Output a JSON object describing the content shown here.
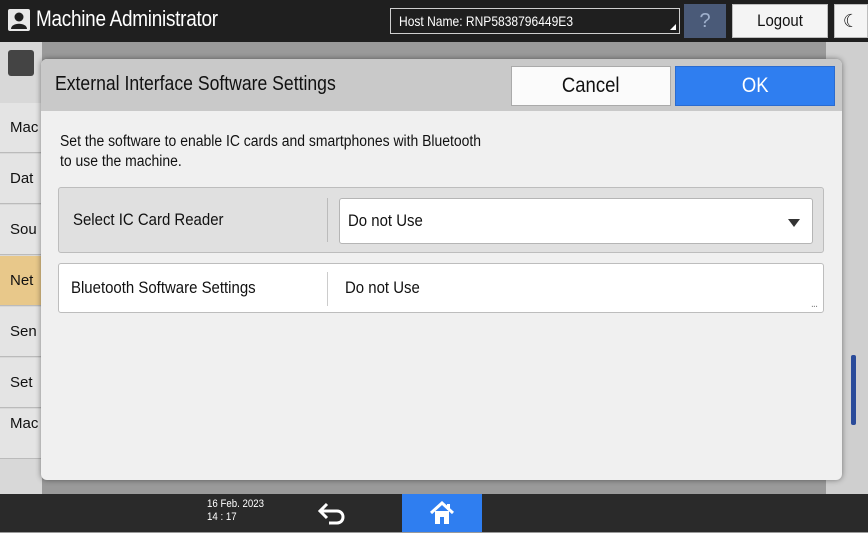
{
  "topbar": {
    "user_icon": "user-icon",
    "title": "Machine Administrator",
    "host": "Host Name: RNP5838796449E3",
    "help_label": "?",
    "logout_label": "Logout",
    "moon_icon": "moon-icon"
  },
  "sidebar": {
    "items": [
      {
        "label": "Mac"
      },
      {
        "label": "Dat"
      },
      {
        "label": "Sou"
      },
      {
        "label": "Net"
      },
      {
        "label": "Sen"
      },
      {
        "label": "Set"
      },
      {
        "label": "Mac Info"
      }
    ]
  },
  "dialog": {
    "title": "External Interface Software Settings",
    "cancel_label": "Cancel",
    "ok_label": "OK",
    "description_line1": "Set the software to enable IC cards and smartphones with Bluetooth",
    "description_line2": "to use the machine.",
    "ic_card": {
      "label": "Select IC Card Reader",
      "value": "Do not Use"
    },
    "bluetooth": {
      "label": "Bluetooth Software Settings",
      "value": "Do not Use",
      "more": "..."
    }
  },
  "bottombar": {
    "date": "16 Feb. 2023",
    "time": "14 : 17",
    "back_icon": "back-arrow-icon",
    "home_icon": "home-icon"
  },
  "colors": {
    "accent": "#2f7ef0",
    "topbar": "#1f1f1f",
    "active_tab": "#e8c88a"
  }
}
